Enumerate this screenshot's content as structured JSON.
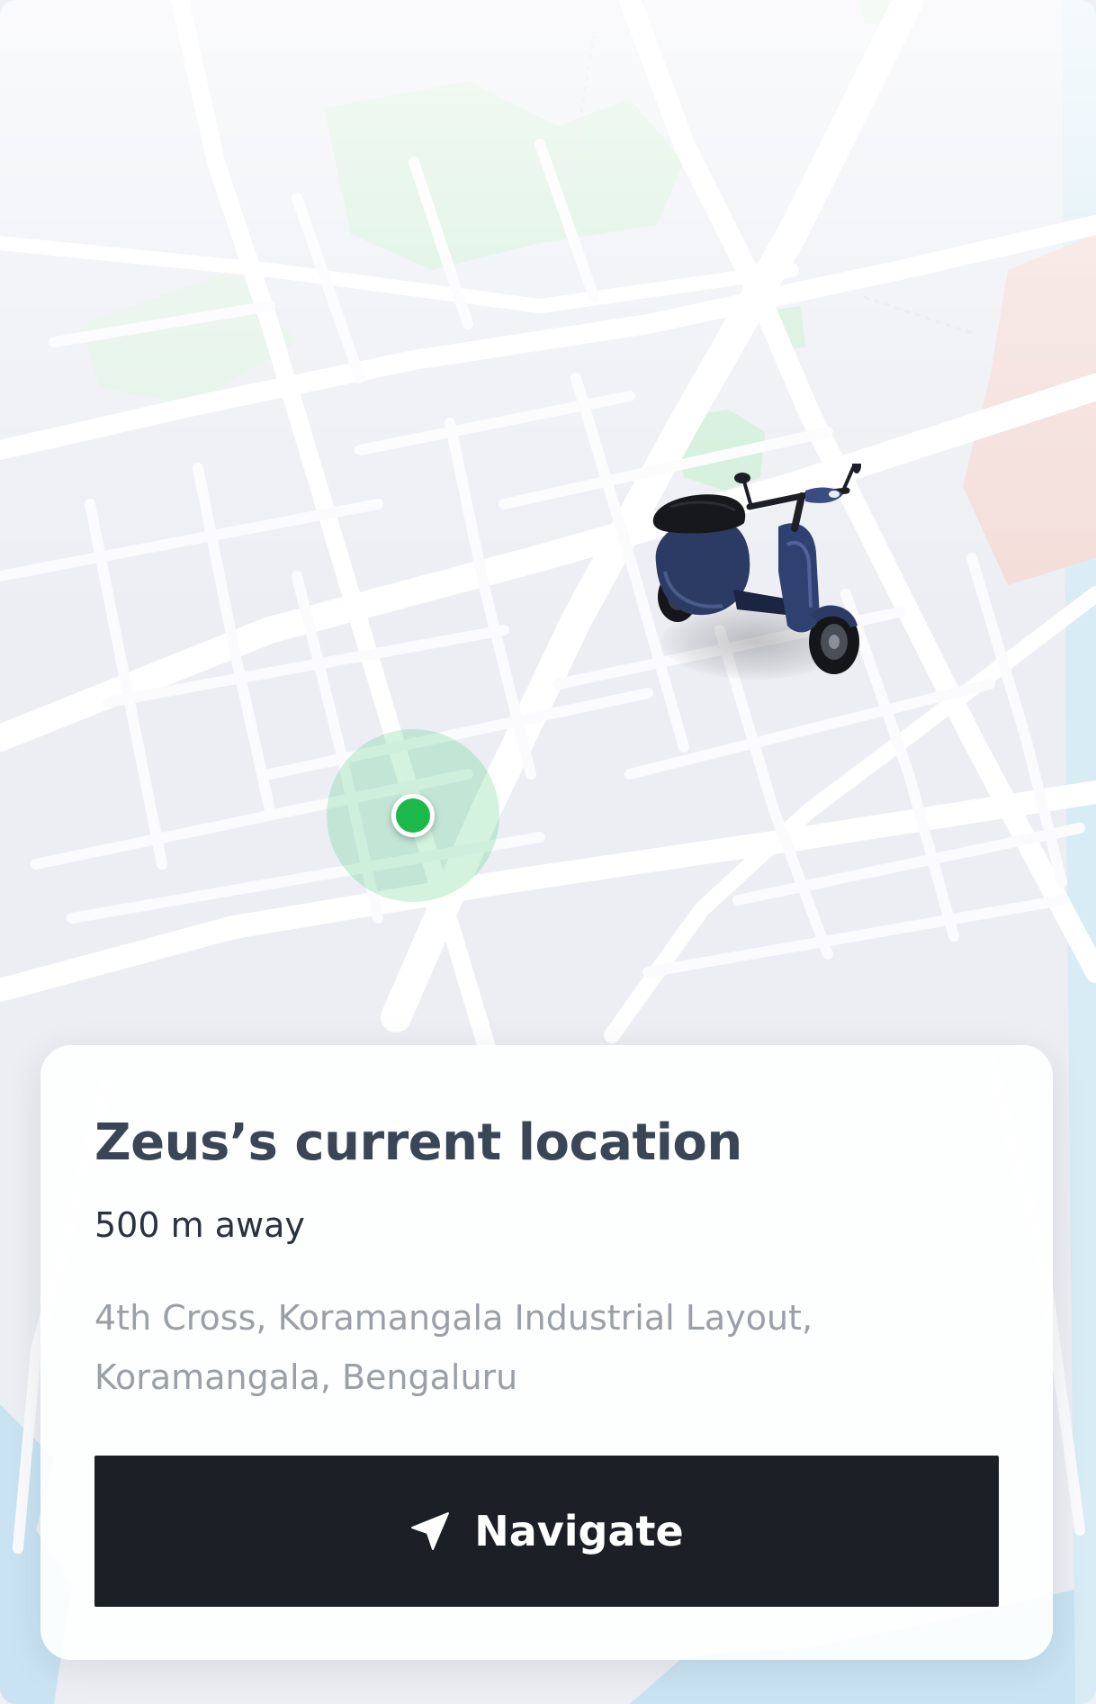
{
  "map": {
    "user_location_icon": "location-dot-icon",
    "vehicle_icon": "scooter-icon"
  },
  "location_card": {
    "title": "Zeus’s current location",
    "distance": "500 m away",
    "address_line1": "4th Cross, Koramangala Industrial Layout,",
    "address_line2": "Koramangala, Bengaluru",
    "navigate_label": "Navigate",
    "navigate_icon": "navigation-arrow-icon"
  },
  "colors": {
    "accent_green": "#1db84a",
    "button_dark": "#1c2026",
    "title_text": "#3a4656",
    "secondary_text": "#9aa0a8"
  }
}
